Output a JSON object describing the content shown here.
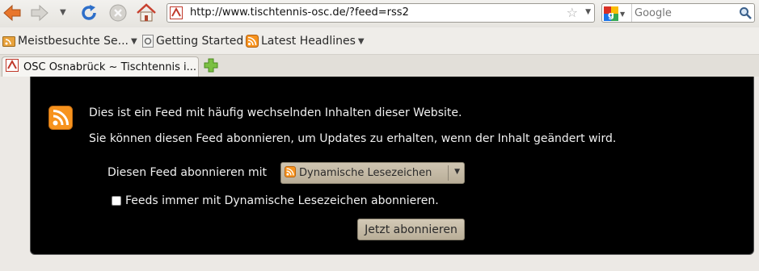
{
  "toolbar": {
    "url": "http://www.tischtennis-osc.de/?feed=rss2",
    "search_placeholder": "Google"
  },
  "bookmarks": [
    {
      "label": "Meistbesuchte Se..."
    },
    {
      "label": "Getting Started"
    },
    {
      "label": "Latest Headlines"
    }
  ],
  "tabs": [
    {
      "title": "OSC Osnabrück ~ Tischtennis i..."
    }
  ],
  "feed": {
    "info_line1": "Dies ist ein Feed mit häufig wechselnden Inhalten dieser Website.",
    "info_line2": "Sie können diesen Feed abonnieren, um Updates zu erhalten, wenn der Inhalt geändert wird.",
    "subscribe_with_label": "Diesen Feed abonnieren mit",
    "selected_reader": "Dynamische Lesezeichen",
    "always_use_label": "Feeds immer mit Dynamische Lesezeichen abonnieren.",
    "always_use_checked": false,
    "subscribe_button": "Jetzt abonnieren"
  },
  "colors": {
    "feed_background": "#000000",
    "button_background": "#c6bba6",
    "rss_orange": "#f7931e"
  }
}
